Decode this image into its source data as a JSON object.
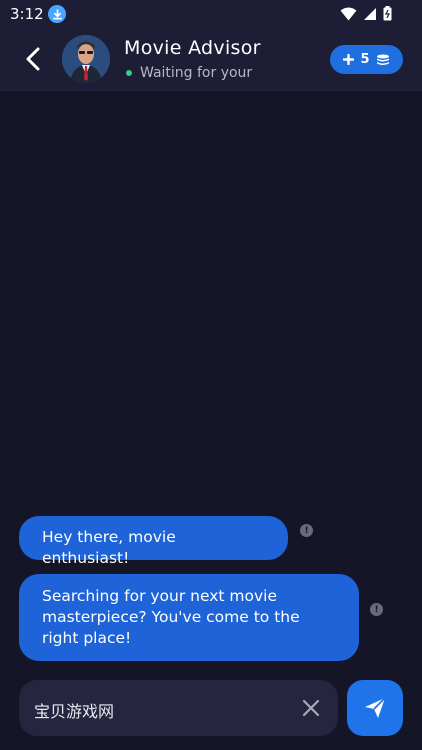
{
  "status_bar": {
    "time": "3:12",
    "icons": [
      "download-notification-icon",
      "wifi-icon",
      "signal-icon",
      "battery-icon"
    ]
  },
  "header": {
    "title": "Movie Advisor",
    "status": "Waiting for your",
    "credits_count": "5",
    "colors": {
      "accent": "#1f6fe0",
      "online": "#2fd27d"
    }
  },
  "messages": [
    {
      "text": "Hey there, movie enthusiast!"
    },
    {
      "text": "Searching for your next movie masterpiece? You've come to the right place!"
    }
  ],
  "composer": {
    "value": "宝贝游戏网"
  },
  "theme": {
    "background": "#151528",
    "bubble": "#1e63d8"
  }
}
